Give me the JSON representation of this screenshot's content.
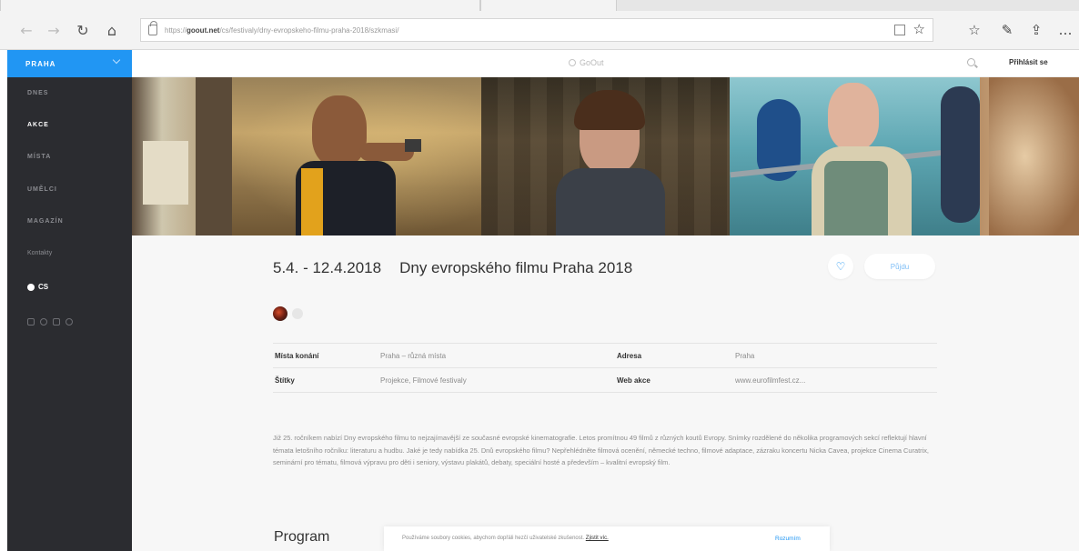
{
  "browser": {
    "url_prefix": "https://",
    "url_domain": "goout.net",
    "url_path": "/cs/festivaly/dny-evropskeho-filmu-praha-2018/szkmasi/",
    "icons": [
      "back-icon",
      "forward-icon",
      "refresh-icon",
      "home-icon",
      "lock-icon",
      "reader-icon",
      "star-icon",
      "favorites-icon",
      "pen-icon",
      "share-icon",
      "more-icon"
    ]
  },
  "sidebar": {
    "city": "PRAHA",
    "items": [
      {
        "label": "DNES",
        "active": false
      },
      {
        "label": "AKCE",
        "active": true
      },
      {
        "label": "MÍSTA",
        "active": false
      },
      {
        "label": "UMĚLCI",
        "active": false
      },
      {
        "label": "MAGAZÍN",
        "active": false
      },
      {
        "label": "Kontakty",
        "active": false
      }
    ],
    "language": "CS"
  },
  "topbar": {
    "logo": "GoOut",
    "login": "Přihlásit se"
  },
  "event": {
    "date": "5.4. - 12.4.2018",
    "title": "Dny evropského filmu Praha 2018",
    "go_label": "Půjdu",
    "like_icon": "heart-icon",
    "info": {
      "venue_label": "Místa konání",
      "venue_value": "Praha – různá místa",
      "address_label": "Adresa",
      "address_value": "Praha",
      "tags_label": "Štítky",
      "tags_value": "Projekce, Filmové festivaly",
      "web_label": "Web akce",
      "web_value": "www.eurofilmfest.cz..."
    },
    "description": "Již 25. ročníkem nabízí Dny evropského filmu to nejzajímavější ze současné evropské kinematografie. Letos promítnou 49 filmů z různých koutů Evropy. Snímky rozdělené do několika programových sekcí reflektují hlavní témata letošního ročníku: literaturu a hudbu. Jaké je tedy nabídka 25. Dnů evropského filmu? Nepřehlédněte filmová ocenění, německé techno, filmové adaptace, zázraku koncertu Nicka Cavea, projekce Cinema Curatrix, seminární pro tématu, filmová výpravu pro děti i seniory, výstavu plakátů, debaty, speciální hosté a především – kvalitní evropský film."
  },
  "program_heading": "Program",
  "cookie": {
    "text": "Používáme soubory cookies, abychom dopřáli hezčí uživatelské zkušenost.",
    "link": "Zjistit víc.",
    "ok": "Rozumím"
  },
  "colors": {
    "accent": "#2196f3",
    "sidebar_bg": "#2b2c30"
  }
}
